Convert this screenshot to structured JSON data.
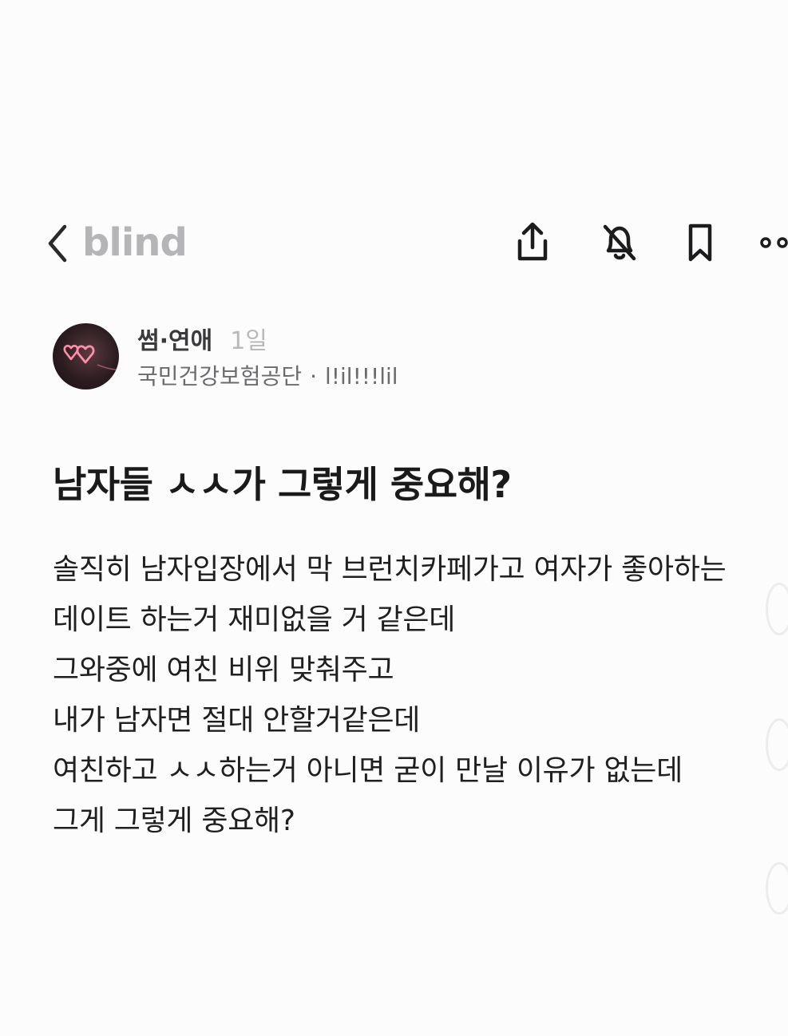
{
  "header": {
    "logo": "blind",
    "icons": {
      "back": "chevron-left-icon",
      "share": "share-icon",
      "notifications": "bell-off-icon",
      "bookmark": "bookmark-icon",
      "more": "more-icon"
    }
  },
  "author": {
    "channel": "썸·연애",
    "age": "1일",
    "company": "국민건강보험공단",
    "separator": "·",
    "nickname": "l!il!!!lil"
  },
  "post": {
    "title": "남자들 ㅅㅅ가 그렇게 중요해?",
    "lines": [
      "솔직히 남자입장에서 막 브런치카페가고 여자가 좋아하는",
      "데이트 하는거 재미없을 거 같은데",
      "그와중에 여친 비위 맞춰주고",
      "내가 남자면 절대 안할거같은데",
      "여친하고 ㅅㅅ하는거 아니면 굳이 만날 이유가 없는데",
      "그게 그렇게 중요해?"
    ]
  },
  "colors": {
    "background": "#fdfcfd",
    "text": "#1a1a1a",
    "logo": "#b5b5b7",
    "muted": "#b9b9bb",
    "secondary": "#6b6b6e",
    "icon": "#1c1c1e",
    "avatar_heart": "#ff8fa8"
  }
}
